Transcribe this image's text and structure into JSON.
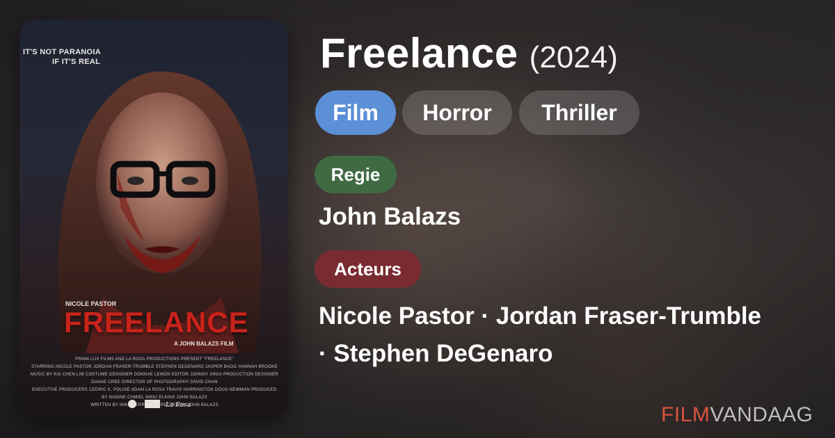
{
  "poster": {
    "tagline_line1": "IT'S NOT PARANOIA",
    "tagline_line2": "IF IT'S REAL",
    "actor_name": "NICOLE PASTOR",
    "title": "FREELANCE",
    "subtitle": "A JOHN BALAZS FILM",
    "credits": [
      "PRIMA LUX FILMS AND LA ROSA PRODUCTIONS PRESENT \"FREELANCE\"",
      "STARRING NICOLE PASTOR JORDAN FRASER-TRUMBLE STEPHEN DEGENARO JASPER BAGG HANNAH BROOKE",
      "MUSIC BY KAI CHEN LIM COSTUME DESIGNER DONNAE LEMON EDITOR JOHNNY ARGA PRODUCTION DESIGNER DANAE CREE DIRECTOR OF PHOTOGRAPHY DAVID CHAN",
      "EXECUTIVE PRODUCERS CEDRIC K. POLIGE ADAM LA ROSA TRAVIS HARRINGTON DOUG NEWMAN PRODUCED BY NADINE CHMIEL NIKKI ELKINS JOHN BALAZS",
      "WRITTEN BY MIKE CERRONE DIRECTED BY JOHN BALAZS"
    ],
    "logo_text": "La Rosa"
  },
  "movie": {
    "title": "Freelance",
    "year": "(2024)",
    "tags": [
      "Film",
      "Horror",
      "Thriller"
    ],
    "director_label": "Regie",
    "director": "John Balazs",
    "cast_label": "Acteurs",
    "cast_line1": "Nicole Pastor · Jordan Fraser-Trumble",
    "cast_line2": "· Stephen DeGenaro"
  },
  "brand": {
    "part1": "FILM",
    "part2": "VANDAAG"
  },
  "colors": {
    "film_tag": "#5b8fd6",
    "regie_label": "#3f6a42",
    "acteurs_label": "#7a2b32",
    "brand_accent": "#d9533e",
    "poster_title": "#c8231b"
  }
}
